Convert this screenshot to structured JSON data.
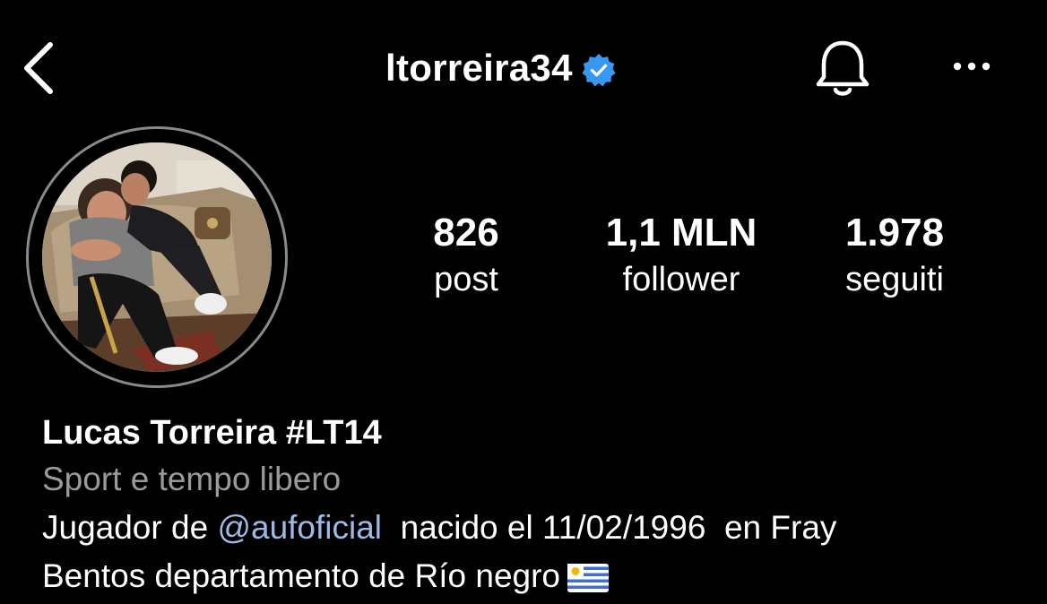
{
  "header": {
    "username": "ltorreira34",
    "verified": true,
    "icons": [
      "chevron-left-icon",
      "verified-badge-icon",
      "bell-icon",
      "more-horizontal-icon"
    ]
  },
  "colors": {
    "background": "#000000",
    "text": "#ffffff",
    "secondary_text": "#9a9a9a",
    "verified_blue": "#3897f0",
    "mention": "#9fb9e6"
  },
  "stats": {
    "posts": {
      "value": "826",
      "label": "post"
    },
    "followers": {
      "value": "1,1 MLN",
      "label": "follower"
    },
    "following": {
      "value": "1.978",
      "label": "seguiti"
    }
  },
  "bio": {
    "full_name": "Lucas Torreira #LT14",
    "category": "Sport e tempo libero",
    "line1_prefix": "Jugador de ",
    "mention": "@aufoficial",
    "line1_suffix": "  nacido el 11/02/1996  en Fray",
    "line2": "Bentos departamento de Río negro",
    "flag_icon": "uruguay-flag-icon"
  }
}
